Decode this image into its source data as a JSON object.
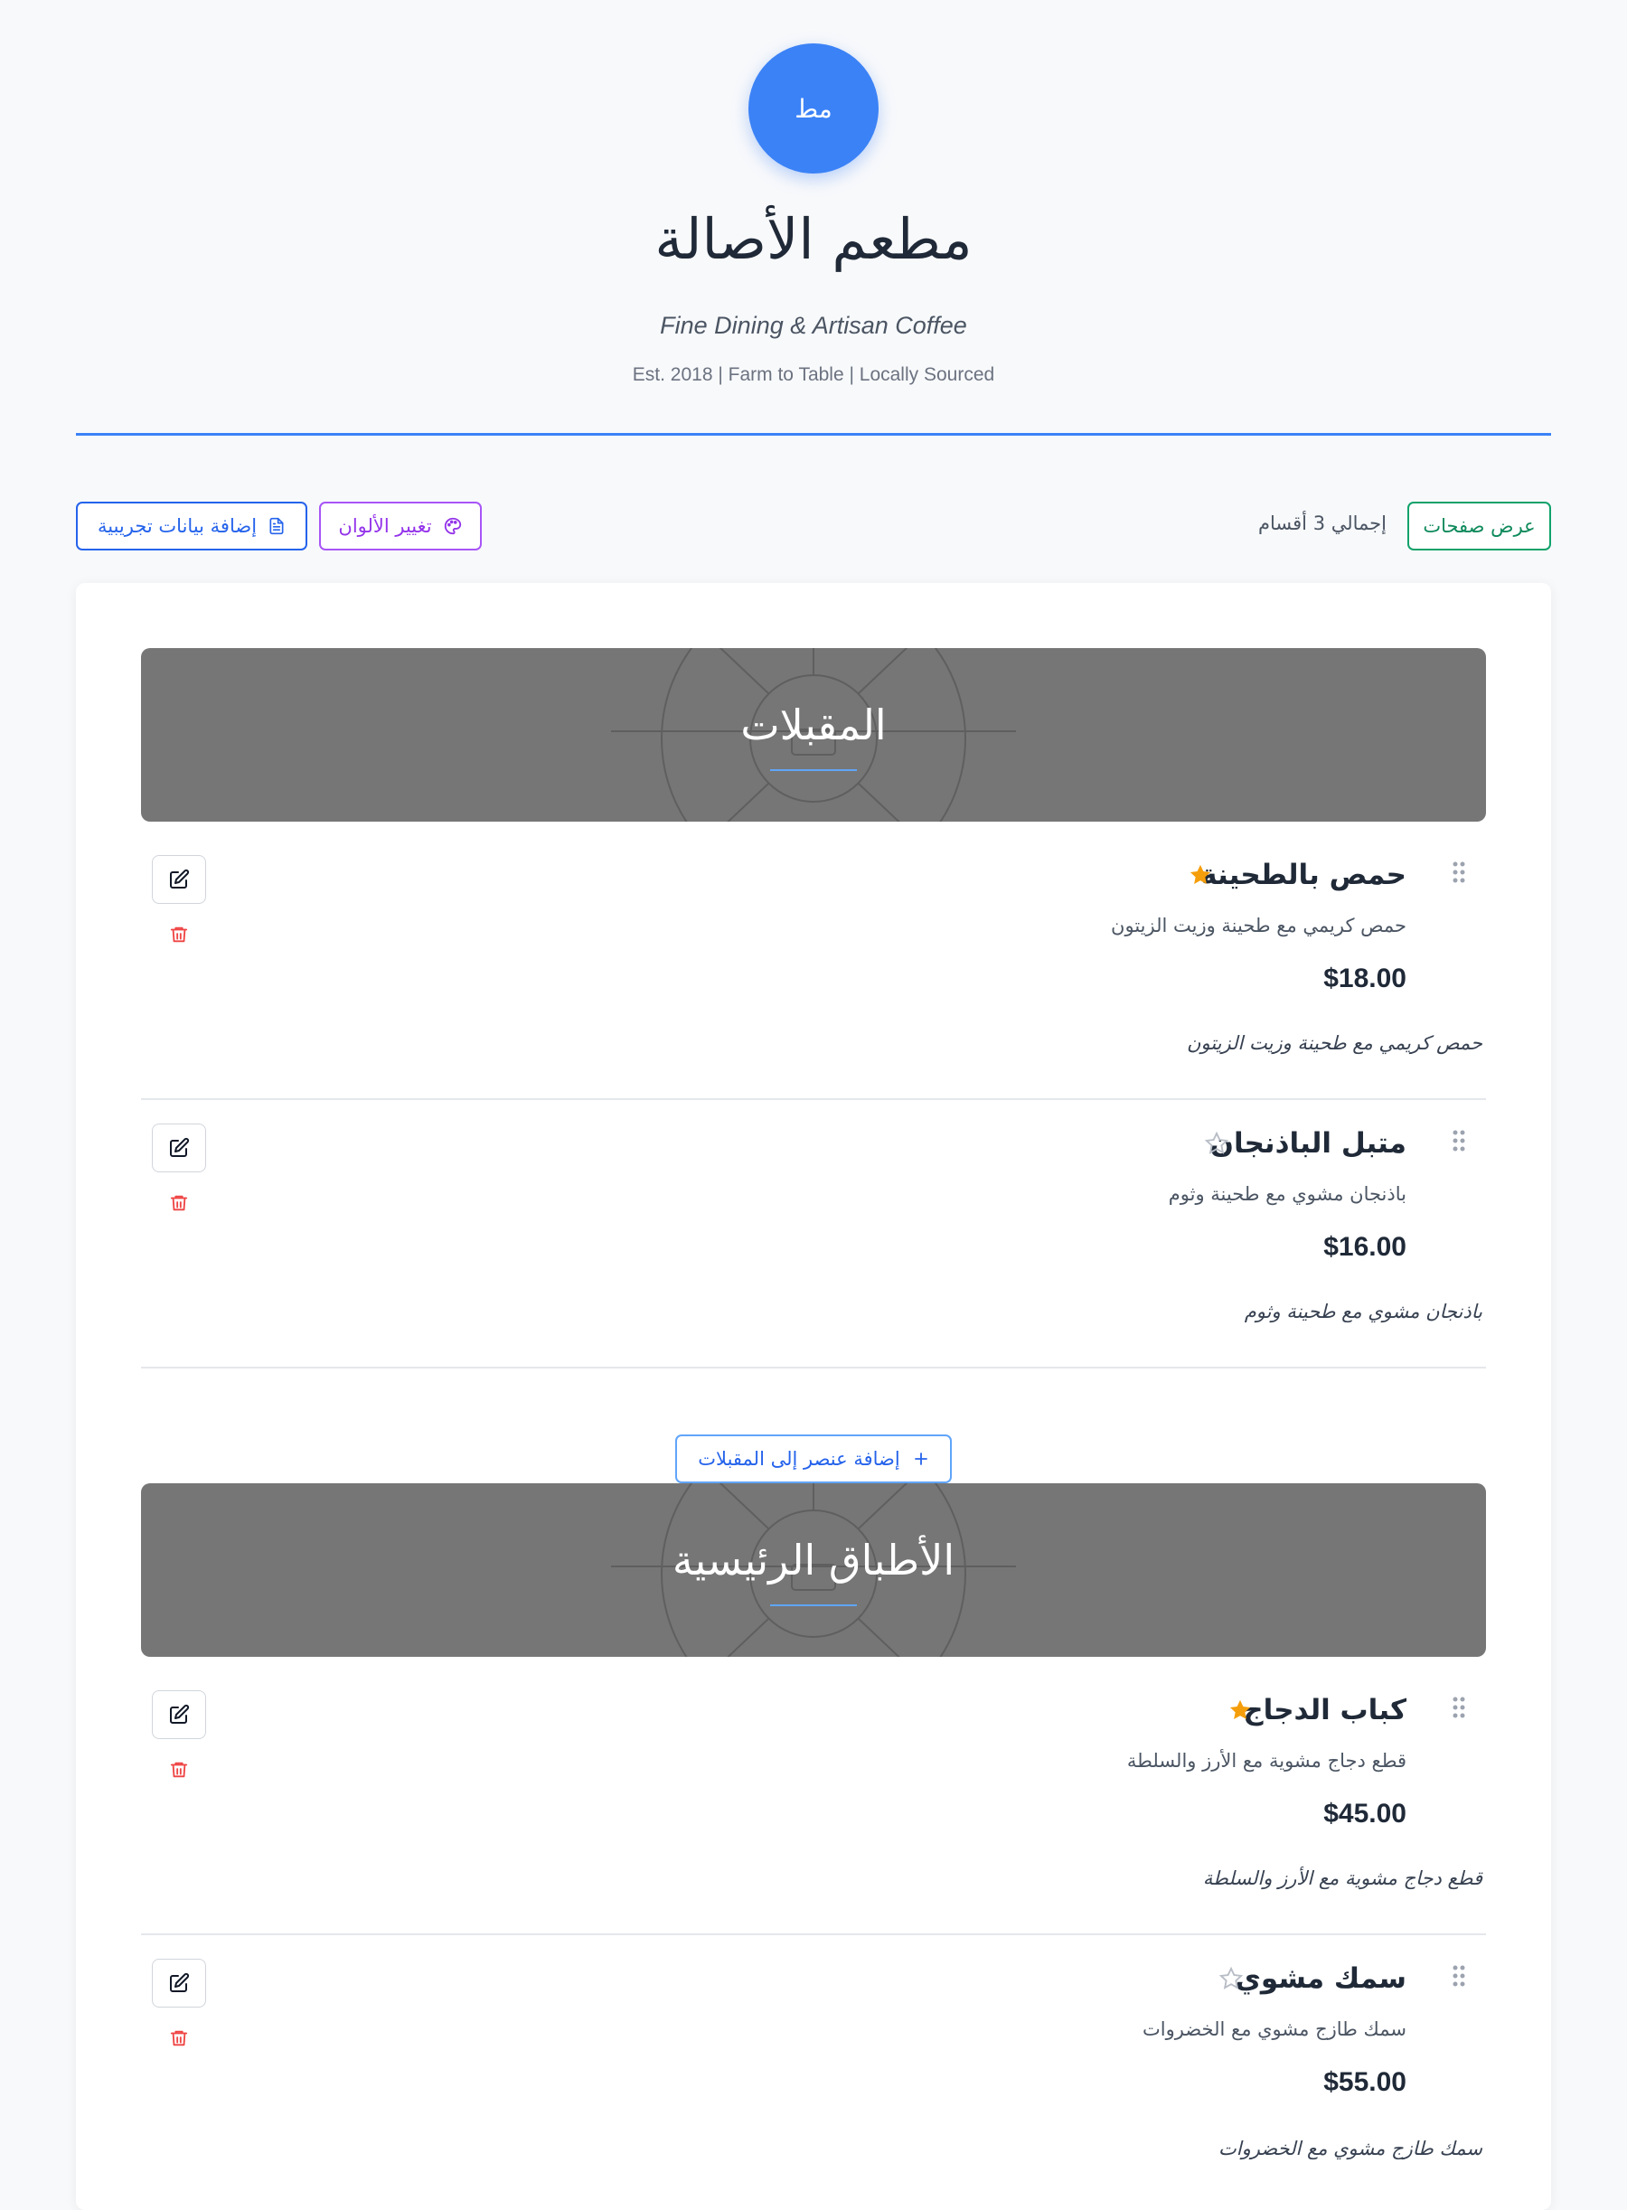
{
  "header": {
    "logo_text": "مط",
    "title": "مطعم الأصالة",
    "tagline": "Fine Dining & Artisan Coffee",
    "established": "Est. 2018 | Farm to Table | Locally Sourced"
  },
  "toolbar": {
    "view_pages_label": "عرض صفحات",
    "total_sections": "إجمالي 3 أقسام",
    "change_colors_label": "تغيير الألوان",
    "add_sample_data_label": "إضافة بيانات تجريبية"
  },
  "colors": {
    "accent": "#3b82f6",
    "view_pages": "#10a26b",
    "change_colors": "#a855f7",
    "sample_data": "#2563eb",
    "featured_star": "#f59e0b",
    "banner_bg": "#767676",
    "delete": "#ef4444"
  },
  "icons": {
    "drag": "drag-handle-icon",
    "star_filled": "star-filled-icon",
    "star_outline": "star-outline-icon",
    "edit": "edit-icon",
    "delete": "trash-icon",
    "palette": "palette-icon",
    "document": "document-icon",
    "plus": "plus-icon"
  },
  "sections": [
    {
      "title": "المقبلات",
      "add_item_label": "إضافة عنصر إلى المقبلات",
      "items": [
        {
          "name": "حمص بالطحينة",
          "description": "حمص كريمي مع طحينة وزيت الزيتون",
          "price": "$18.00",
          "note": "حمص كريمي مع طحينة وزيت الزيتون",
          "featured": true
        },
        {
          "name": "متبل الباذنجان",
          "description": "باذنجان مشوي مع طحينة وثوم",
          "price": "$16.00",
          "note": "باذنجان مشوي مع طحينة وثوم",
          "featured": false
        }
      ]
    },
    {
      "title": "الأطباق الرئيسية",
      "items": [
        {
          "name": "كباب الدجاج",
          "description": "قطع دجاج مشوية مع الأرز والسلطة",
          "price": "$45.00",
          "note": "قطع دجاج مشوية مع الأرز والسلطة",
          "featured": true
        },
        {
          "name": "سمك مشوي",
          "description": "سمك طازج مشوي مع الخضروات",
          "price": "$55.00",
          "note": "سمك طازج مشوي مع الخضروات",
          "featured": false
        }
      ]
    }
  ]
}
